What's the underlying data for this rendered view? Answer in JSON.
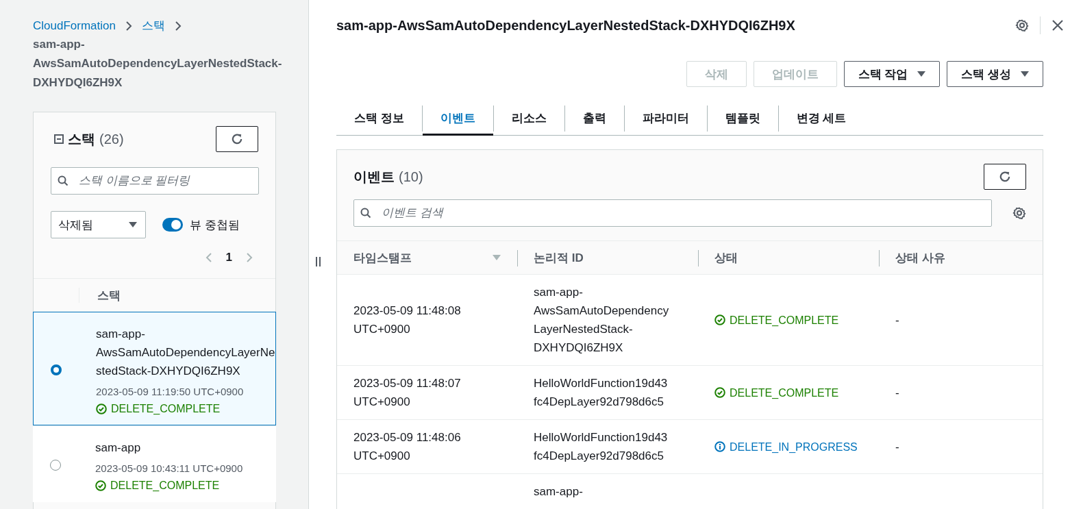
{
  "breadcrumb": {
    "items": [
      "CloudFormation",
      "스택"
    ],
    "current": "sam-app-AwsSamAutoDependencyLayerNestedStack-DXHYDQI6ZH9X"
  },
  "stacks_panel": {
    "title": "스택",
    "count": "(26)",
    "search": {
      "placeholder": "스택 이름으로 필터링"
    },
    "filter": {
      "value": "삭제됨"
    },
    "nested_toggle": {
      "label": "뷰 중첩됨",
      "on": true
    },
    "pagination": {
      "page": "1"
    },
    "column": "스택",
    "rows": [
      {
        "name": "sam-app-AwsSamAutoDependencyLayerNestedStack-DXHYDQI6ZH9X",
        "time": "2023-05-09 11:19:50 UTC+0900",
        "status": "DELETE_COMPLETE",
        "kind": "complete",
        "selected": true
      },
      {
        "name": "sam-app",
        "time": "2023-05-09 10:43:11 UTC+0900",
        "status": "DELETE_COMPLETE",
        "kind": "complete",
        "selected": false
      }
    ]
  },
  "detail": {
    "title": "sam-app-AwsSamAutoDependencyLayerNestedStack-DXHYDQI6ZH9X",
    "buttons": [
      {
        "label": "삭제",
        "disabled": true,
        "dropdown": false
      },
      {
        "label": "업데이트",
        "disabled": true,
        "dropdown": false
      },
      {
        "label": "스택 작업",
        "disabled": false,
        "dropdown": true
      },
      {
        "label": "스택 생성",
        "disabled": false,
        "dropdown": true
      }
    ],
    "tabs": [
      {
        "label": "스택 정보",
        "selected": false
      },
      {
        "label": "이벤트",
        "selected": true
      },
      {
        "label": "리소스",
        "selected": false
      },
      {
        "label": "출력",
        "selected": false
      },
      {
        "label": "파라미터",
        "selected": false
      },
      {
        "label": "템플릿",
        "selected": false
      },
      {
        "label": "변경 세트",
        "selected": false
      }
    ],
    "events": {
      "title": "이벤트",
      "count": "(10)",
      "search": {
        "placeholder": "이벤트 검색"
      },
      "columns": [
        "타임스탬프",
        "논리적 ID",
        "상태",
        "상태 사유"
      ],
      "rows": [
        {
          "timestamp": "2023-05-09 11:48:08 UTC+0900",
          "logical_id": "sam-app-AwsSamAutoDependencyLayerNestedStack-DXHYDQI6ZH9X",
          "status": "DELETE_COMPLETE",
          "kind": "complete",
          "reason": "-"
        },
        {
          "timestamp": "2023-05-09 11:48:07 UTC+0900",
          "logical_id": "HelloWorldFunction19d43fc4DepLayer92d798d6c5",
          "status": "DELETE_COMPLETE",
          "kind": "complete",
          "reason": "-"
        },
        {
          "timestamp": "2023-05-09 11:48:06 UTC+0900",
          "logical_id": "HelloWorldFunction19d43fc4DepLayer92d798d6c5",
          "status": "DELETE_IN_PROGRESS",
          "kind": "in_progress",
          "reason": "-"
        },
        {
          "logical_id": "sam-app-"
        }
      ]
    }
  }
}
